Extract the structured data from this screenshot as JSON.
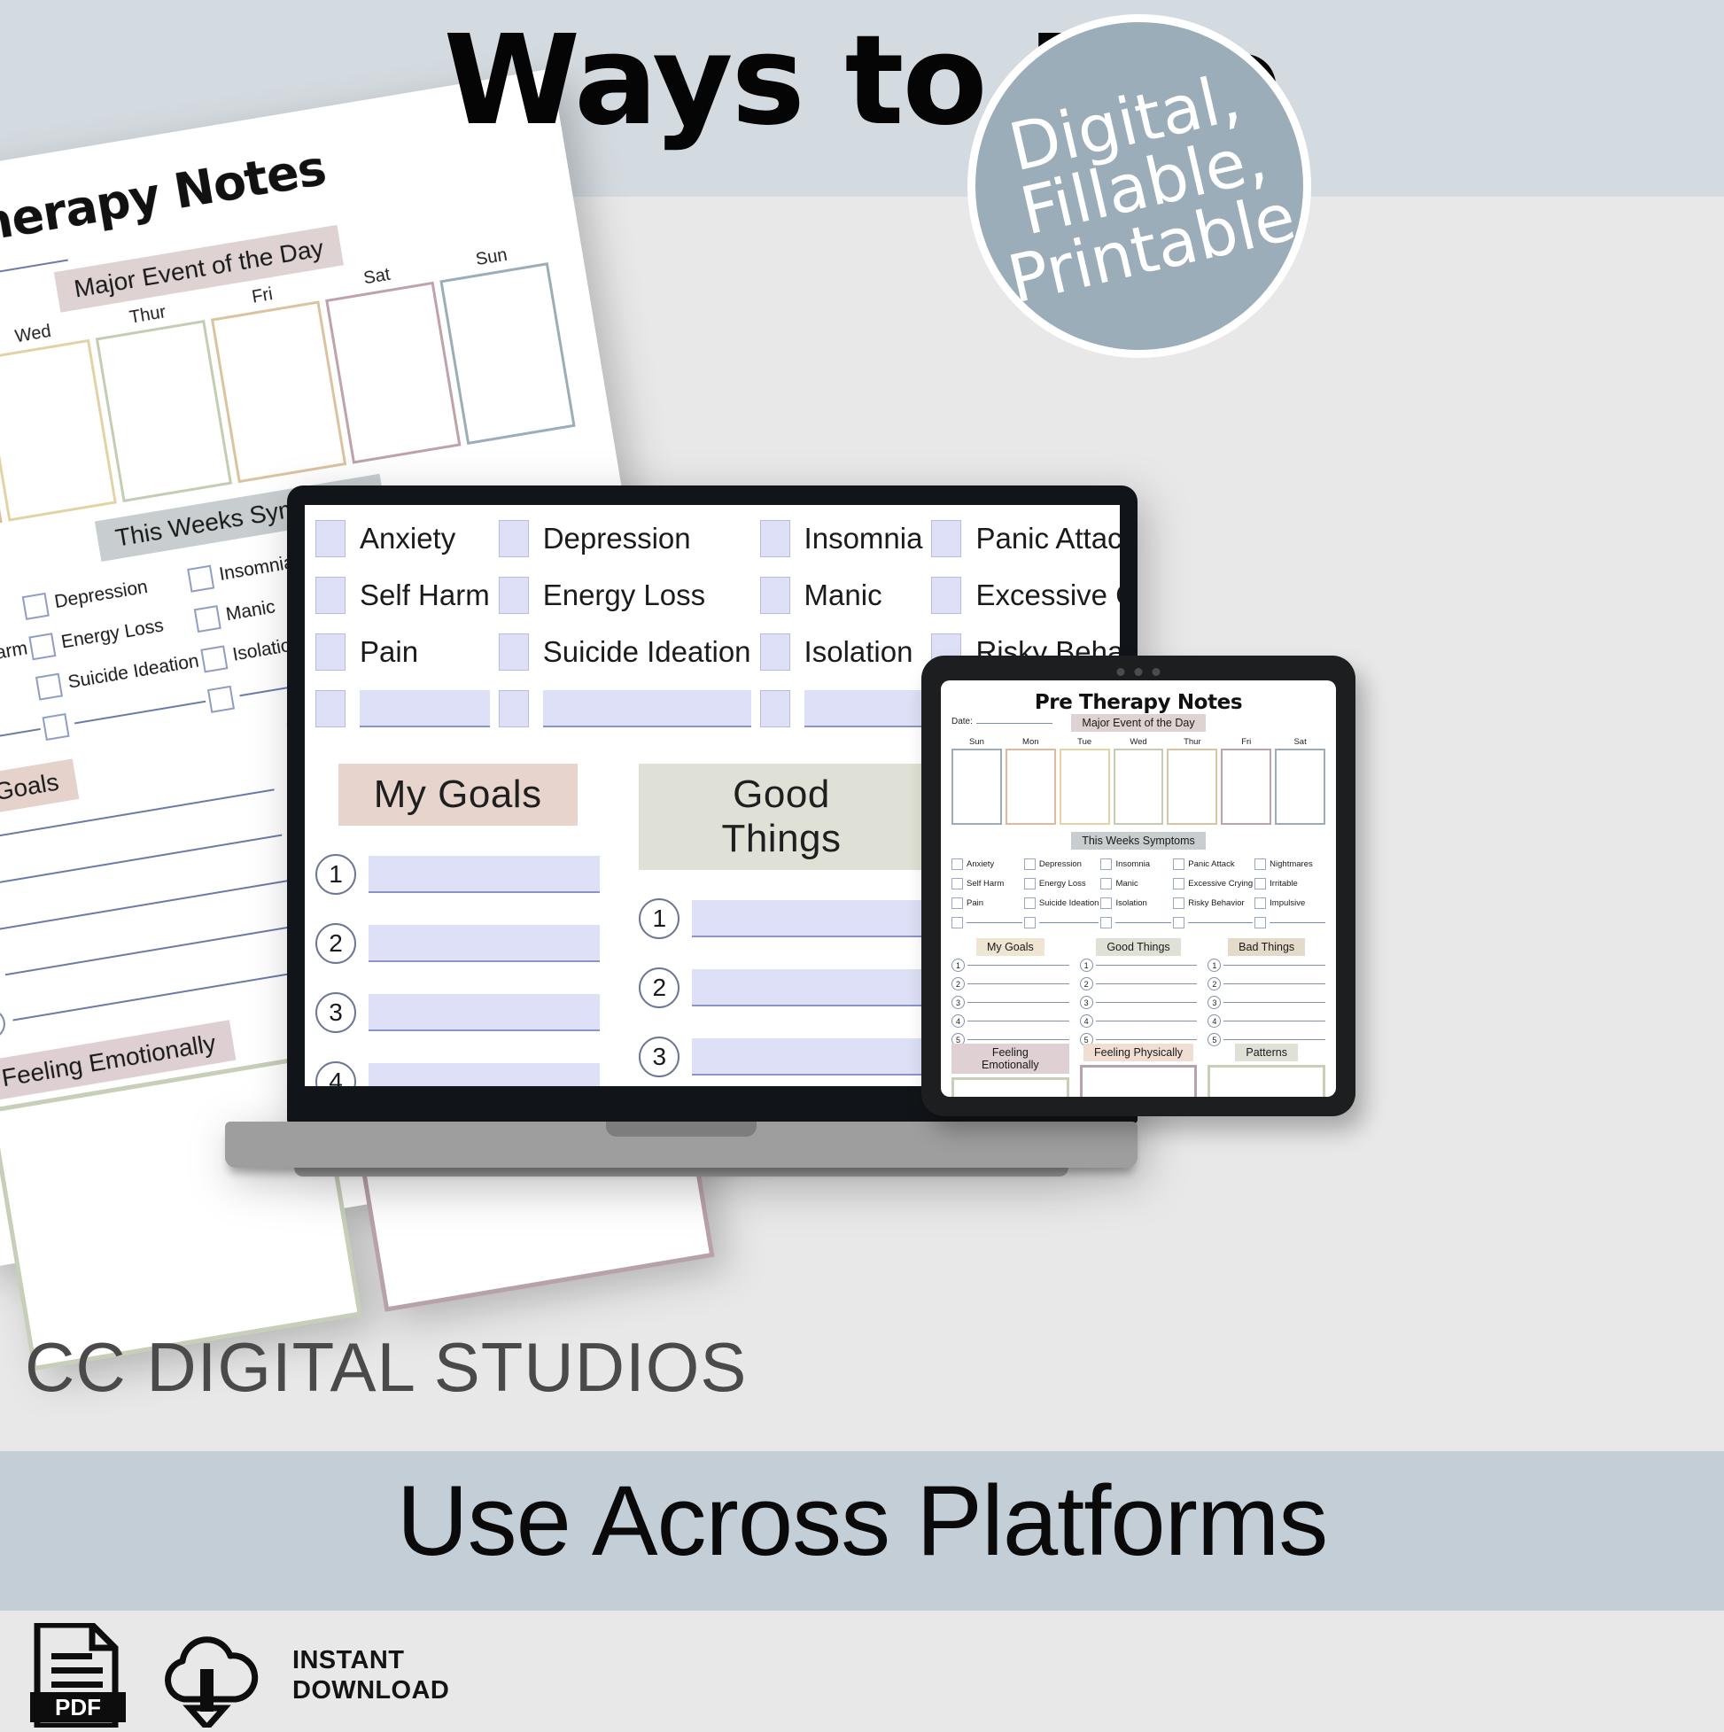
{
  "headline": "Ways to Use",
  "subhead": "Use Across Platforms",
  "brand": "CC DIGITAL STUDIOS",
  "colors": {
    "band_top": "#d4dbe0",
    "band_body": "#e8e8e8",
    "band_accent": "#c3ced7",
    "badge_fill": "#9aadb8",
    "badge_text": "#ffffff",
    "form_field": "#dde0f6",
    "chip_grey": "#c8cecf",
    "chip_pink": "#e5d2cb",
    "chip_sage": "#dee0d6",
    "chip_tan": "#e4dbcd",
    "chip_mauve": "#ded0d2",
    "chip_cream": "#ece6d5",
    "box_sage": "#c7cfb8",
    "box_mauve": "#b9a1a8"
  },
  "badge": {
    "line1": "Digital,",
    "line2": "Fillable,",
    "line3": "Printable"
  },
  "footer": {
    "pdf_label": "PDF",
    "pdf_icon": "pdf-file-icon",
    "download_icon": "cloud-download-icon",
    "download_line1": "INSTANT",
    "download_line2": "DOWNLOAD"
  },
  "planner": {
    "title": "Pre Therapy Notes",
    "date_label": "Date:",
    "major_event_header": "Major Event of the Day",
    "symptoms_header": "This Weeks Symptoms",
    "days_paper": [
      "Tues",
      "Wed",
      "Thur",
      "Fri",
      "Sat",
      "Sun"
    ],
    "days_tablet": [
      "Sun",
      "Mon",
      "Tue",
      "Wed",
      "Thur",
      "Fri",
      "Sat"
    ],
    "day_border_colors": [
      "#9aadb8",
      "#e2b99e",
      "#e3d2a4",
      "#c3cdb4",
      "#dcc39f",
      "#bfa2aa",
      "#9aadb8"
    ],
    "symptom_columns": [
      [
        "Anxiety",
        "Self Harm",
        "Pain"
      ],
      [
        "Depression",
        "Energy Loss",
        "Suicide Ideation"
      ],
      [
        "Insomnia",
        "Manic",
        "Isolation"
      ],
      [
        "Panic Attack",
        "Excessive Crying",
        "Risky Behavior"
      ],
      [
        "Nightmares",
        "Irritable",
        "Impulsive"
      ]
    ],
    "list_sections": [
      {
        "title": "My Goals",
        "chip": "cream",
        "numbers": [
          "1",
          "2",
          "3",
          "4",
          "5"
        ]
      },
      {
        "title": "Good Things",
        "chip": "sage",
        "numbers": [
          "1",
          "2",
          "3",
          "4",
          "5"
        ]
      },
      {
        "title": "Bad Things",
        "chip": "tan",
        "numbers": [
          "1",
          "2",
          "3",
          "4",
          "5"
        ]
      }
    ],
    "box_sections": [
      {
        "title": "Feeling Emotionally",
        "chip": "mauve",
        "border": "sage"
      },
      {
        "title": "Feeling Physically",
        "chip": "peach",
        "border": "mauve"
      },
      {
        "title": "Patterns",
        "chip": "sage",
        "border": "sage"
      }
    ],
    "laptop_list_sections": [
      {
        "title": "My Goals",
        "chip": "pink"
      },
      {
        "title": "Good Things",
        "chip": "sage"
      },
      {
        "title": "Bad Things",
        "chip": "tan"
      }
    ],
    "laptop_box_sections": [
      {
        "title": "Feeling Emotionally",
        "chip": "mauve"
      },
      {
        "title": "Feeling Physically",
        "chip": "cream"
      },
      {
        "title": "Patterns",
        "chip": "sage"
      }
    ],
    "paper_list_sections": [
      {
        "title": "My Goals",
        "chip": "pink"
      },
      {
        "title": "Good Things",
        "chip": "sage"
      }
    ],
    "paper_box_sections": [
      {
        "title": "Feeling Emotionally",
        "chip": "mauve",
        "border": "s"
      },
      {
        "title": "Feeling Physically",
        "chip": "cream",
        "border": "m"
      }
    ]
  }
}
